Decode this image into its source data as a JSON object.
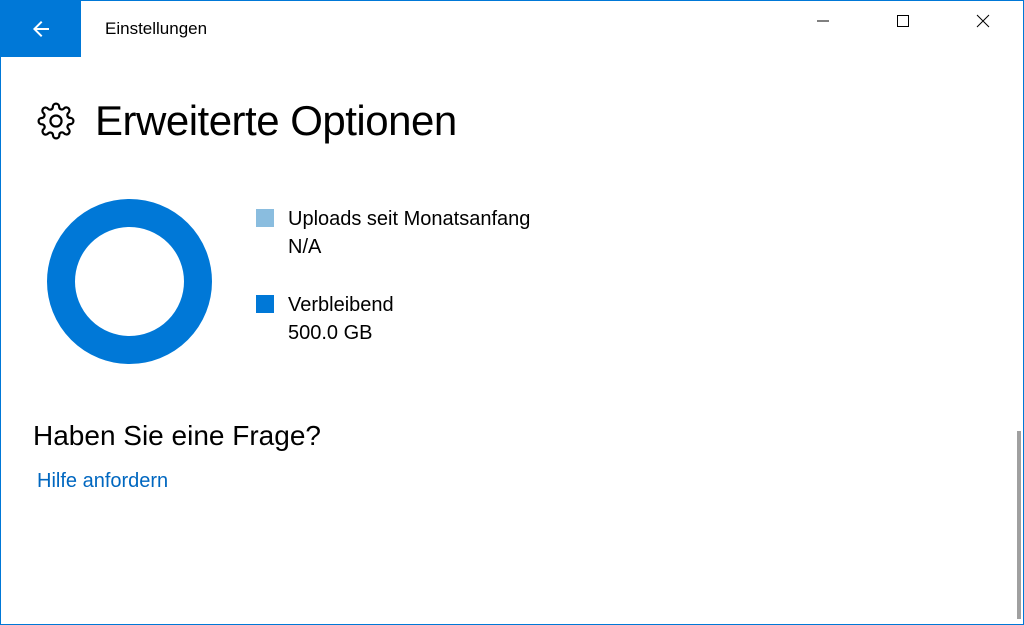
{
  "window": {
    "title": "Einstellungen"
  },
  "page": {
    "title": "Erweiterte Optionen"
  },
  "usage": {
    "uploads_label": "Uploads seit Monatsanfang",
    "uploads_value": "N/A",
    "remaining_label": "Verbleibend",
    "remaining_value": "500.0 GB"
  },
  "help": {
    "heading": "Haben Sie eine Frage?",
    "link": "Hilfe anfordern"
  },
  "colors": {
    "accent": "#0078d7",
    "light_swatch": "#8abddf",
    "link": "#0067c0"
  },
  "chart_data": {
    "type": "pie",
    "title": "",
    "series": [
      {
        "name": "Uploads seit Monatsanfang",
        "value": 0,
        "label": "N/A",
        "color": "#8abddf"
      },
      {
        "name": "Verbleibend",
        "value": 500.0,
        "label": "500.0 GB",
        "color": "#0078d7"
      }
    ]
  }
}
